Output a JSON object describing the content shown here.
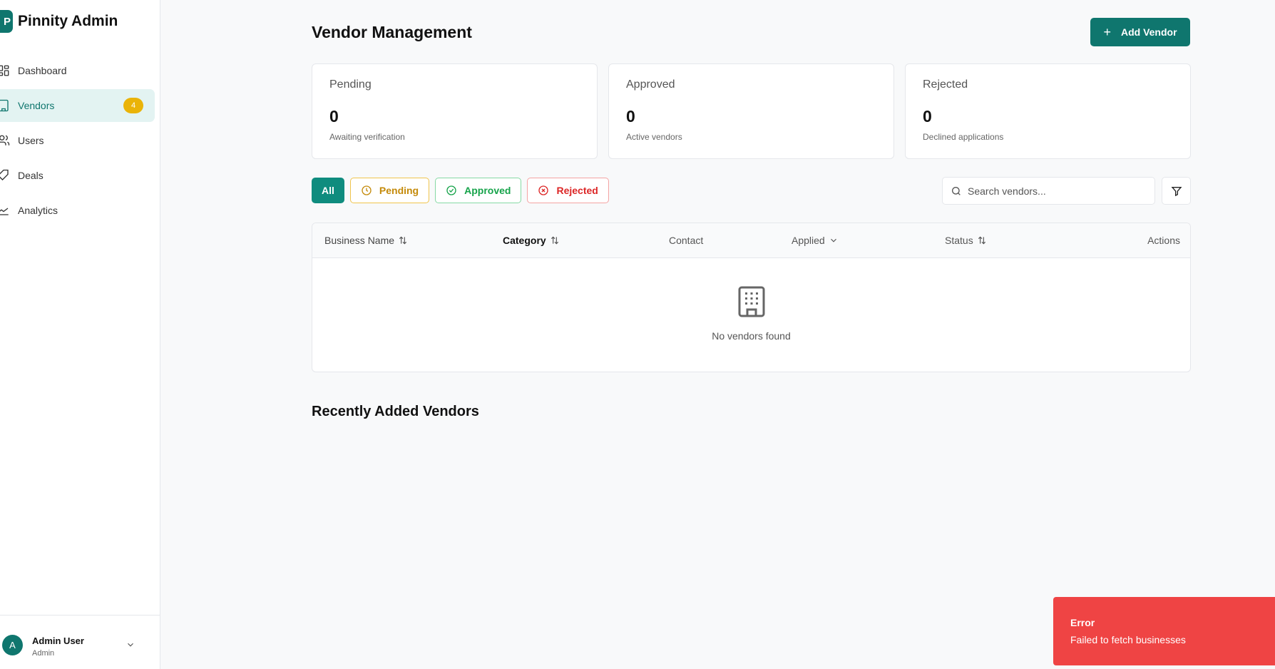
{
  "app": {
    "name": "Pinnity Admin",
    "logo_letter": "P"
  },
  "sidebar": {
    "items": [
      {
        "label": "Dashboard",
        "icon": "layout-dashboard-icon"
      },
      {
        "label": "Vendors",
        "icon": "building-icon",
        "badge": "4",
        "active": true
      },
      {
        "label": "Users",
        "icon": "users-icon"
      },
      {
        "label": "Deals",
        "icon": "tag-icon"
      },
      {
        "label": "Analytics",
        "icon": "chart-line-icon"
      }
    ],
    "user": {
      "initial": "A",
      "name": "Admin User",
      "role": "Admin"
    }
  },
  "header": {
    "title": "Vendor Management",
    "add_button": "Add Vendor"
  },
  "stats": [
    {
      "title": "Pending",
      "value": "0",
      "sub": "Awaiting verification"
    },
    {
      "title": "Approved",
      "value": "0",
      "sub": "Active vendors"
    },
    {
      "title": "Rejected",
      "value": "0",
      "sub": "Declined applications"
    }
  ],
  "filters": {
    "all": "All",
    "pending": "Pending",
    "approved": "Approved",
    "rejected": "Rejected"
  },
  "search": {
    "placeholder": "Search vendors..."
  },
  "table": {
    "columns": {
      "business_name": "Business Name",
      "category": "Category",
      "contact": "Contact",
      "applied": "Applied",
      "status": "Status",
      "actions": "Actions"
    },
    "empty_text": "No vendors found"
  },
  "recent": {
    "title": "Recently Added Vendors"
  },
  "toast": {
    "title": "Error",
    "message": "Failed to fetch businesses"
  },
  "colors": {
    "primary": "#0f766e",
    "badge": "#eab308",
    "pending": "#c48a0a",
    "approved": "#16a34a",
    "rejected": "#dc2626",
    "toast": "#ef4444"
  }
}
